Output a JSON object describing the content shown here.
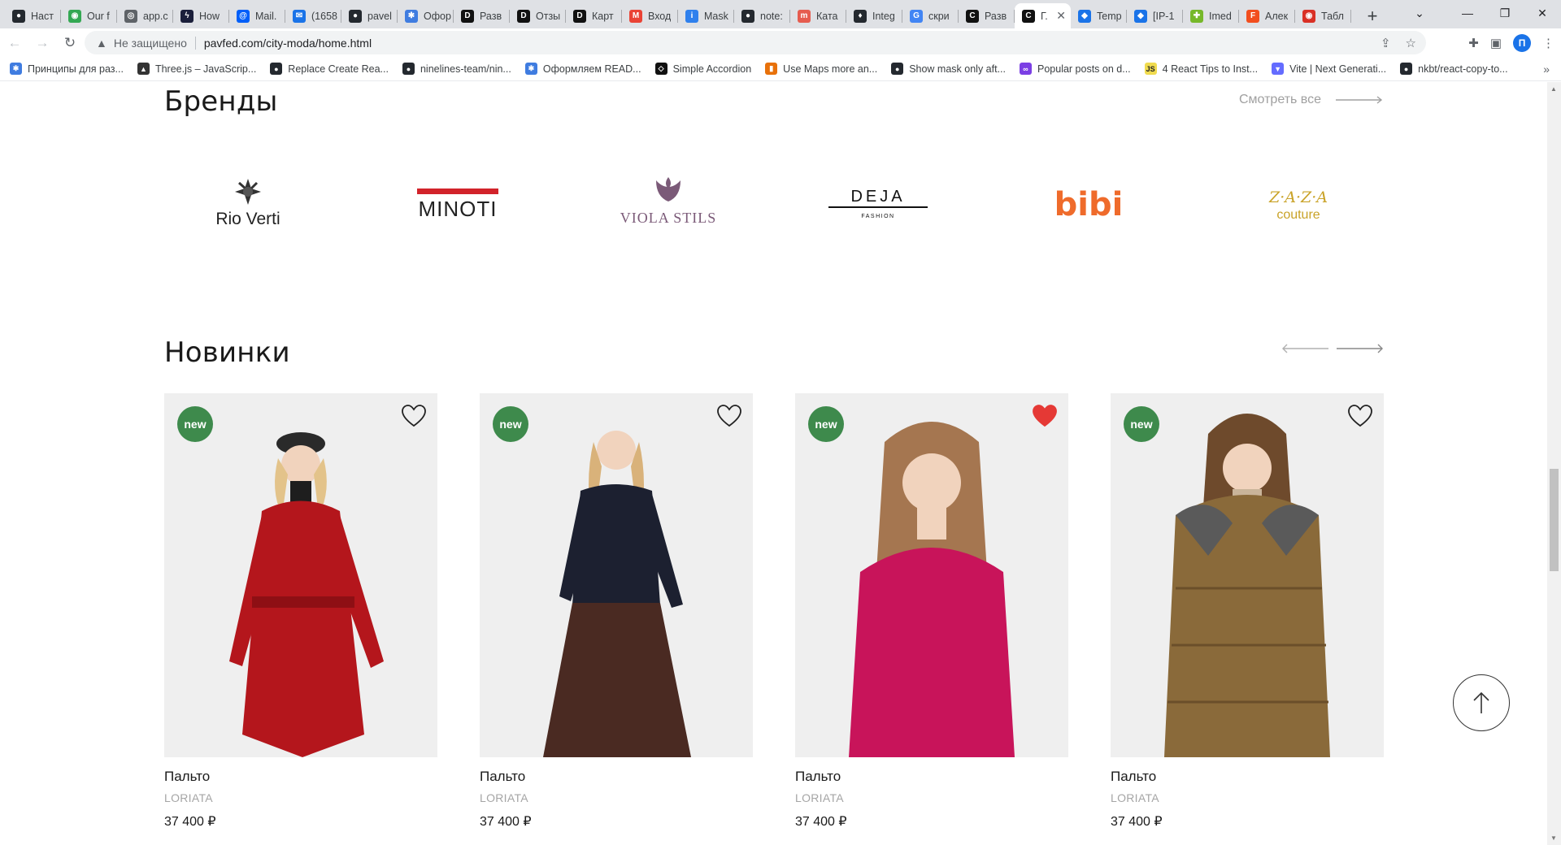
{
  "browser": {
    "tabs": [
      {
        "title": "Наст",
        "icon": "github-icon",
        "color": "#24292f"
      },
      {
        "title": "Our f",
        "icon": "green-circle-icon",
        "color": "#34a853"
      },
      {
        "title": "app.c",
        "icon": "globe-icon",
        "color": "#5f6368"
      },
      {
        "title": "How",
        "icon": "bolt-icon",
        "color": "#1b1f3b"
      },
      {
        "title": "Mail.",
        "icon": "mail-at-icon",
        "color": "#005ff9"
      },
      {
        "title": "(1658",
        "icon": "mail-envelope-icon",
        "color": "#1a73e8"
      },
      {
        "title": "pavel",
        "icon": "github-icon",
        "color": "#24292f"
      },
      {
        "title": "Офор",
        "icon": "gear-square-icon",
        "color": "#3f7ce0"
      },
      {
        "title": "Разв",
        "icon": "deu-icon",
        "color": "#111111"
      },
      {
        "title": "Отзы",
        "icon": "deu-icon",
        "color": "#111111"
      },
      {
        "title": "Карт",
        "icon": "deu-icon",
        "color": "#111111"
      },
      {
        "title": "Вход",
        "icon": "gmail-icon",
        "color": "#ea4335"
      },
      {
        "title": "Mask",
        "icon": "imask-icon",
        "color": "#2f80ed"
      },
      {
        "title": "note:",
        "icon": "github-icon",
        "color": "#24292f"
      },
      {
        "title": "Ката",
        "icon": "m-icon",
        "color": "#e65c4f"
      },
      {
        "title": "Integ",
        "icon": "git-icon",
        "color": "#24292f"
      },
      {
        "title": "скри",
        "icon": "google-icon",
        "color": "#4285f4"
      },
      {
        "title": "Разв",
        "icon": "c-icon",
        "color": "#111111"
      },
      {
        "title": "Г.",
        "icon": "c-icon",
        "color": "#111111",
        "active": true
      },
      {
        "title": "Temp",
        "icon": "diamond-icon",
        "color": "#1a73e8"
      },
      {
        "title": "[IP-1",
        "icon": "diamond-icon",
        "color": "#1a73e8"
      },
      {
        "title": "Imed",
        "icon": "imed-icon",
        "color": "#76b82a"
      },
      {
        "title": "Алек",
        "icon": "figma-icon",
        "color": "#f24e1e"
      },
      {
        "title": "Табл",
        "icon": "table-icon",
        "color": "#d93025"
      }
    ],
    "address": {
      "insecure_label": "Не защищено",
      "url": "pavfed.com/city-moda/home.html"
    },
    "profile_letter": "П",
    "bookmarks": [
      {
        "label": "Принципы для раз...",
        "icon": "gear-square-icon",
        "color": "#3f7ce0"
      },
      {
        "label": "Three.js – JavaScrip...",
        "icon": "threejs-icon",
        "color": "#333333"
      },
      {
        "label": "Replace Create Rea...",
        "icon": "github-icon",
        "color": "#24292f"
      },
      {
        "label": "ninelines-team/nin...",
        "icon": "github-icon",
        "color": "#24292f"
      },
      {
        "label": "Оформляем READ...",
        "icon": "gear-square-icon",
        "color": "#3f7ce0"
      },
      {
        "label": "Simple Accordion",
        "icon": "codepen-icon",
        "color": "#111111"
      },
      {
        "label": "Use Maps more an...",
        "icon": "bookmark-orange-icon",
        "color": "#e8710a"
      },
      {
        "label": "Show mask only aft...",
        "icon": "github-icon",
        "color": "#24292f"
      },
      {
        "label": "Popular posts on d...",
        "icon": "infinity-icon",
        "color": "#7b3fe4"
      },
      {
        "label": "4 React Tips to Inst...",
        "icon": "js-icon",
        "color": "#f0db4f"
      },
      {
        "label": "Vite | Next Generati...",
        "icon": "vite-icon",
        "color": "#646cff"
      },
      {
        "label": "nkbt/react-copy-to...",
        "icon": "github-icon",
        "color": "#24292f"
      }
    ]
  },
  "page": {
    "brands_section": {
      "title": "Бренды",
      "see_all": "Смотреть все",
      "brands": [
        {
          "name": "Rio Verti"
        },
        {
          "name": "MINOTI"
        },
        {
          "name": "VIOLA STILS"
        },
        {
          "name": "DEJA",
          "sub": "FASHION"
        },
        {
          "name": "bibi"
        },
        {
          "name": "Z·A·Z·A",
          "sub": "couture"
        }
      ]
    },
    "new_section": {
      "title": "Новинки",
      "products": [
        {
          "badge": "new",
          "name": "Пальто",
          "brand": "LORIATA",
          "price": "37 400 ₽",
          "favorite": false,
          "garment_color": "#b4161c",
          "garment": "red coat"
        },
        {
          "badge": "new",
          "name": "Пальто",
          "brand": "LORIATA",
          "price": "37 400 ₽",
          "favorite": false,
          "garment_color": "#1c2030",
          "garment": "navy sweater and brown skirt"
        },
        {
          "badge": "new",
          "name": "Пальто",
          "brand": "LORIATA",
          "price": "37 400 ₽",
          "favorite": true,
          "garment_color": "#c8145a",
          "garment": "magenta sweater"
        },
        {
          "badge": "new",
          "name": "Пальто",
          "brand": "LORIATA",
          "price": "37 400 ₽",
          "favorite": false,
          "garment_color": "#8a6a3a",
          "garment": "bronze puffer jacket"
        }
      ]
    },
    "colors": {
      "badge": "#3e8a4c",
      "heart_active": "#e53935",
      "muted_text": "#a5a5a5"
    }
  }
}
